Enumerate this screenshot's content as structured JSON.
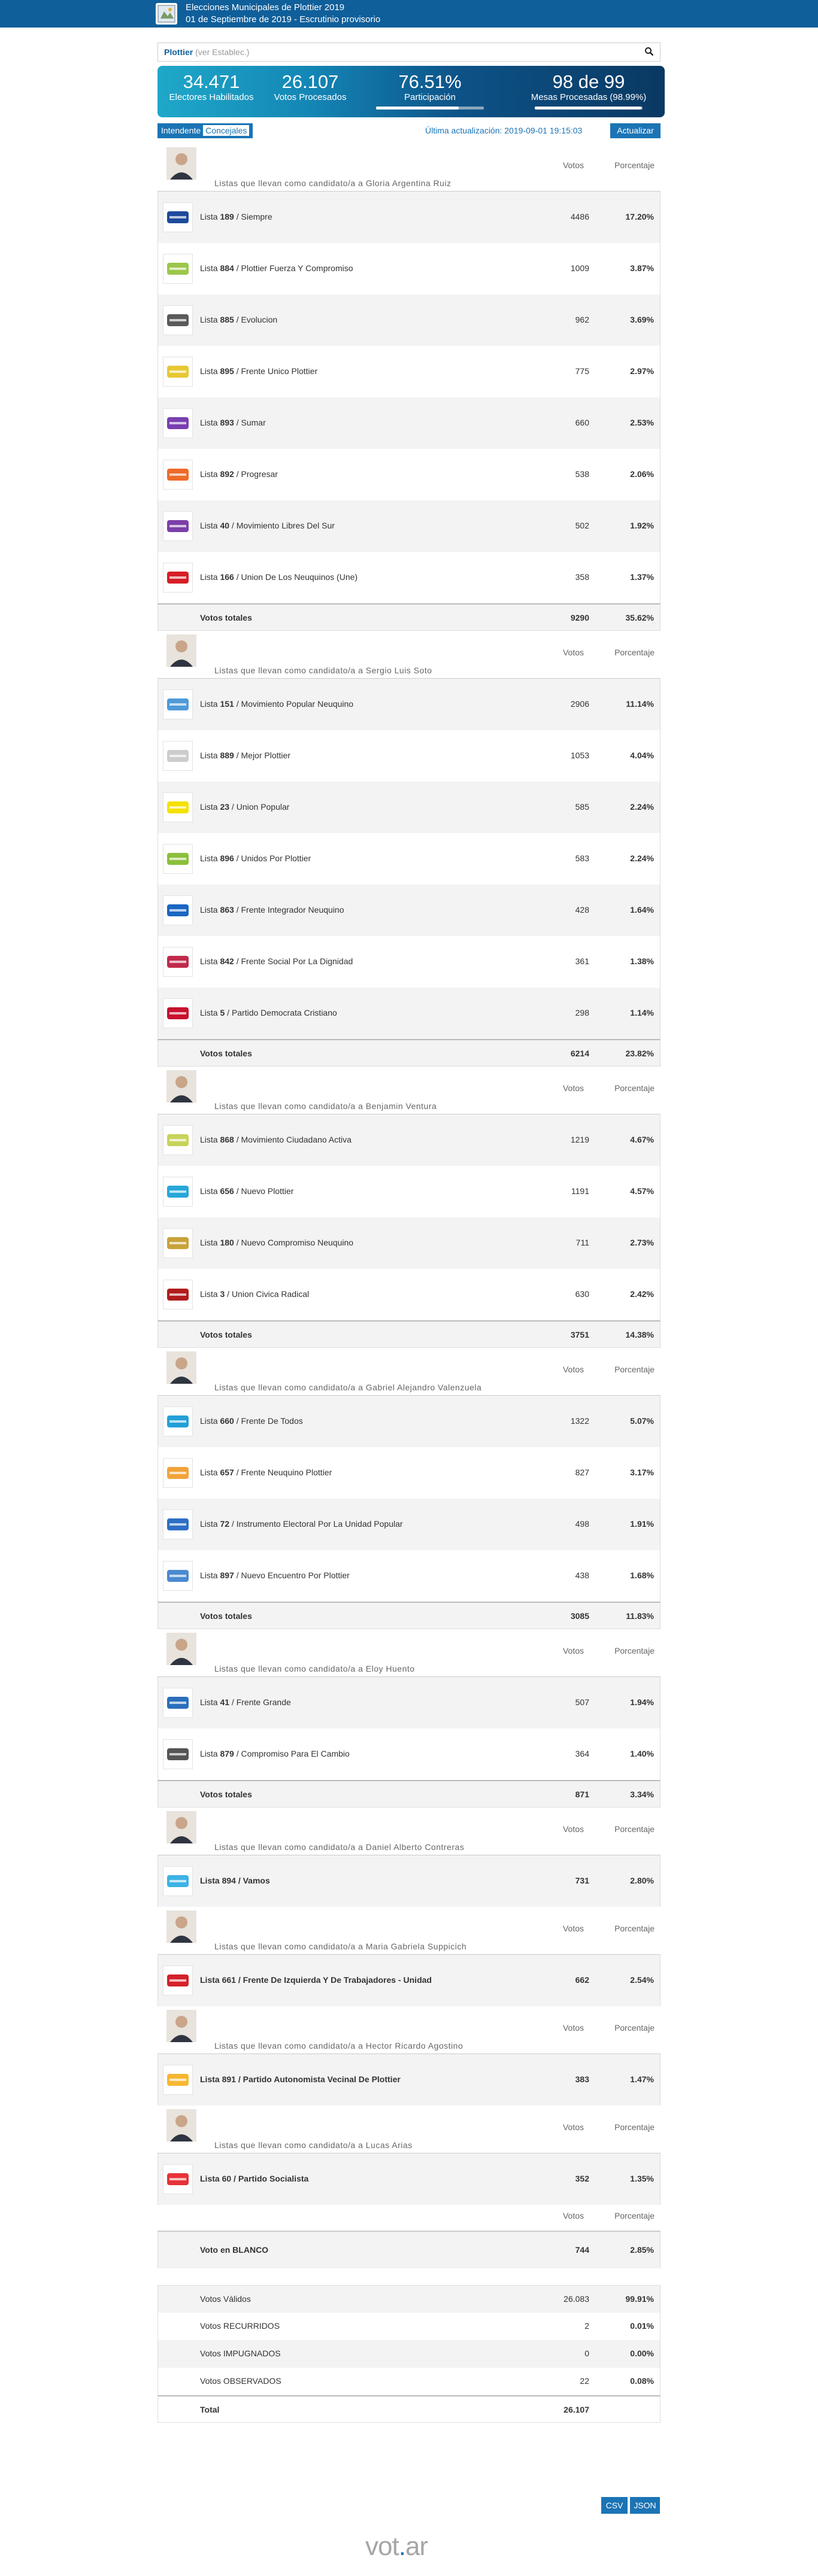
{
  "header": {
    "title": "Elecciones Municipales de Plottier 2019",
    "subtitle": "01 de Septiembre de 2019 - Escrutinio provisorio"
  },
  "search": {
    "value": "Plottier",
    "hint": "(ver Establec.)"
  },
  "stats": {
    "electores": "34.471",
    "electores_label": "Electores Habilitados",
    "votos": "26.107",
    "votos_label": "Votos Procesados",
    "participacion": "76.51%",
    "participacion_label": "Participación",
    "participacion_fill": 0.7651,
    "mesas": "98 de 99",
    "mesas_label": "Mesas Procesadas (98.99%)",
    "mesas_fill": 0.9899
  },
  "controls": {
    "intendente": "Intendente",
    "concejales": "Concejales",
    "updated": "Última actualización: 2019-09-01 19:15:03",
    "refresh": "Actualizar"
  },
  "columns": {
    "votos": "Votos",
    "porcentaje": "Porcentaje"
  },
  "groups": [
    {
      "candidate": "Listas que llevan como candidato/a a Gloria Argentina Ruiz",
      "lists": [
        {
          "num": "189",
          "name": "Siempre",
          "votes": "4486",
          "pct": "17.20%"
        },
        {
          "num": "884",
          "name": "Plottier Fuerza Y Compromiso",
          "votes": "1009",
          "pct": "3.87%"
        },
        {
          "num": "885",
          "name": "Evolucion",
          "votes": "962",
          "pct": "3.69%"
        },
        {
          "num": "895",
          "name": "Frente Unico Plottier",
          "votes": "775",
          "pct": "2.97%"
        },
        {
          "num": "893",
          "name": "Sumar",
          "votes": "660",
          "pct": "2.53%"
        },
        {
          "num": "892",
          "name": "Progresar",
          "votes": "538",
          "pct": "2.06%"
        },
        {
          "num": "40",
          "name": "Movimiento Libres Del Sur",
          "votes": "502",
          "pct": "1.92%"
        },
        {
          "num": "166",
          "name": "Union De Los Neuquinos (Une)",
          "votes": "358",
          "pct": "1.37%"
        }
      ],
      "total_label": "Votos totales",
      "total_votes": "9290",
      "total_pct": "35.62%"
    },
    {
      "candidate": "Listas que llevan como candidato/a a Sergio Luis Soto",
      "lists": [
        {
          "num": "151",
          "name": "Movimiento Popular Neuquino",
          "votes": "2906",
          "pct": "11.14%"
        },
        {
          "num": "889",
          "name": "Mejor Plottier",
          "votes": "1053",
          "pct": "4.04%"
        },
        {
          "num": "23",
          "name": "Union Popular",
          "votes": "585",
          "pct": "2.24%"
        },
        {
          "num": "896",
          "name": "Unidos Por Plottier",
          "votes": "583",
          "pct": "2.24%"
        },
        {
          "num": "863",
          "name": "Frente Integrador Neuquino",
          "votes": "428",
          "pct": "1.64%"
        },
        {
          "num": "842",
          "name": "Frente Social Por La Dignidad",
          "votes": "361",
          "pct": "1.38%"
        },
        {
          "num": "5",
          "name": "Partido Democrata Cristiano",
          "votes": "298",
          "pct": "1.14%"
        }
      ],
      "total_label": "Votos totales",
      "total_votes": "6214",
      "total_pct": "23.82%"
    },
    {
      "candidate": "Listas que llevan como candidato/a a Benjamin Ventura",
      "lists": [
        {
          "num": "868",
          "name": "Movimiento Ciudadano Activa",
          "votes": "1219",
          "pct": "4.67%"
        },
        {
          "num": "656",
          "name": "Nuevo Plottier",
          "votes": "1191",
          "pct": "4.57%"
        },
        {
          "num": "180",
          "name": "Nuevo Compromiso Neuquino",
          "votes": "711",
          "pct": "2.73%"
        },
        {
          "num": "3",
          "name": "Union Civica Radical",
          "votes": "630",
          "pct": "2.42%"
        }
      ],
      "total_label": "Votos totales",
      "total_votes": "3751",
      "total_pct": "14.38%"
    },
    {
      "candidate": "Listas que llevan como candidato/a a Gabriel Alejandro Valenzuela",
      "lists": [
        {
          "num": "660",
          "name": "Frente De Todos",
          "votes": "1322",
          "pct": "5.07%"
        },
        {
          "num": "657",
          "name": "Frente Neuquino Plottier",
          "votes": "827",
          "pct": "3.17%"
        },
        {
          "num": "72",
          "name": "Instrumento Electoral Por La Unidad Popular",
          "votes": "498",
          "pct": "1.91%"
        },
        {
          "num": "897",
          "name": "Nuevo Encuentro Por Plottier",
          "votes": "438",
          "pct": "1.68%"
        }
      ],
      "total_label": "Votos totales",
      "total_votes": "3085",
      "total_pct": "11.83%"
    },
    {
      "candidate": "Listas que llevan como candidato/a a Eloy Huento",
      "lists": [
        {
          "num": "41",
          "name": "Frente Grande",
          "votes": "507",
          "pct": "1.94%"
        },
        {
          "num": "879",
          "name": "Compromiso Para El Cambio",
          "votes": "364",
          "pct": "1.40%"
        }
      ],
      "total_label": "Votos totales",
      "total_votes": "871",
      "total_pct": "3.34%"
    },
    {
      "candidate": "Listas que llevan como candidato/a a Daniel Alberto Contreras",
      "lists": [
        {
          "num": "894",
          "name": "Vamos",
          "votes": "731",
          "pct": "2.80%"
        }
      ]
    },
    {
      "candidate": "Listas que llevan como candidato/a a Maria Gabriela Suppicich",
      "lists": [
        {
          "num": "661",
          "name": "Frente De Izquierda Y De Trabajadores - Unidad",
          "votes": "662",
          "pct": "2.54%"
        }
      ]
    },
    {
      "candidate": "Listas que llevan como candidato/a a Hector Ricardo Agostino",
      "lists": [
        {
          "num": "891",
          "name": "Partido Autonomista Vecinal De Plottier",
          "votes": "383",
          "pct": "1.47%"
        }
      ]
    },
    {
      "candidate": "Listas que llevan como candidato/a a Lucas Arias",
      "lists": [
        {
          "num": "60",
          "name": "Partido Socialista",
          "votes": "352",
          "pct": "1.35%"
        }
      ]
    }
  ],
  "lista_prefix": "Lista",
  "blanco": {
    "label": "Voto en BLANCO",
    "votes": "744",
    "pct": "2.85%"
  },
  "summary": [
    {
      "label": "Votos Válidos",
      "votes": "26.083",
      "pct": "99.91%"
    },
    {
      "label": "Votos RECURRIDOS",
      "votes": "2",
      "pct": "0.01%"
    },
    {
      "label": "Votos IMPUGNADOS",
      "votes": "0",
      "pct": "0.00%"
    },
    {
      "label": "Votos OBSERVADOS",
      "votes": "22",
      "pct": "0.08%"
    }
  ],
  "total": {
    "label": "Total",
    "votes": "26.107"
  },
  "footer": {
    "csv": "CSV",
    "json": "JSON",
    "brand_a": "vot",
    "brand_dot": ".",
    "brand_b": "ar"
  }
}
